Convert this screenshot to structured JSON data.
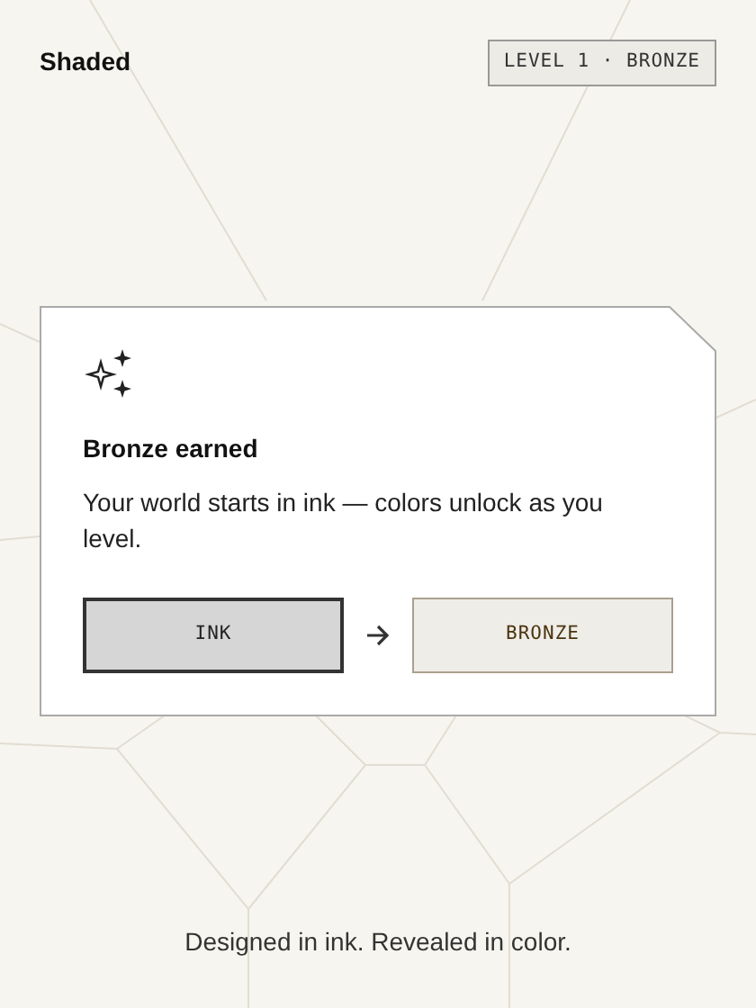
{
  "app": {
    "title": "Shaded",
    "level_badge": "LEVEL 1 · BRONZE"
  },
  "card": {
    "title": "Bronze earned",
    "message": "Your world starts in ink — colors unlock as you level.",
    "swatches": [
      {
        "label": "INK",
        "selected": true
      },
      {
        "label": "BRONZE",
        "selected": false
      }
    ]
  },
  "footer": "Designed in ink. Revealed in color."
}
